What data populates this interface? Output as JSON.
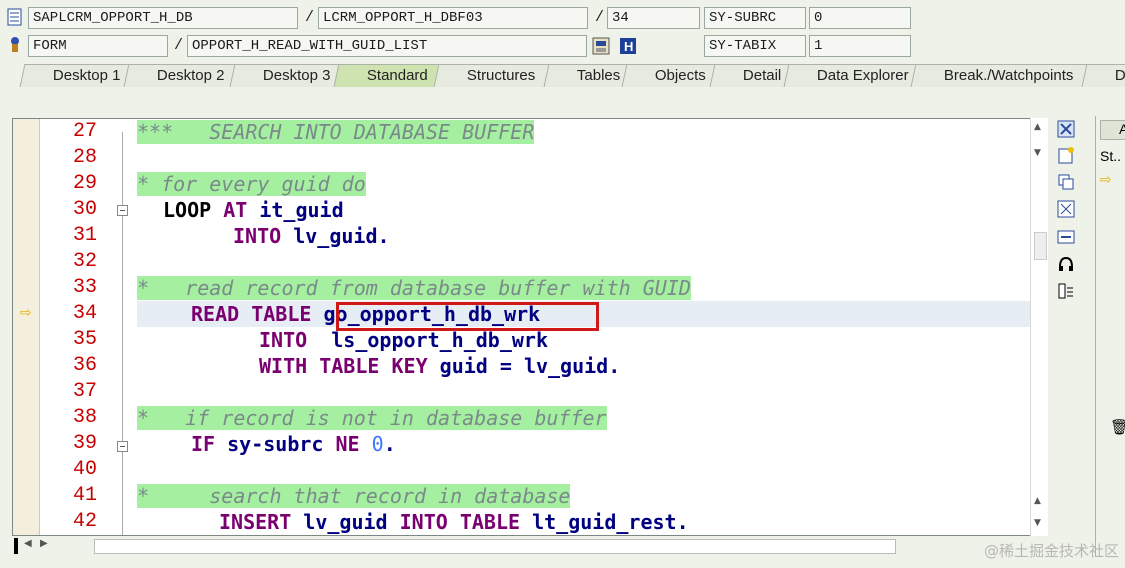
{
  "header": {
    "row1": {
      "program": "SAPLCRM_OPPORT_H_DB",
      "include": "LCRM_OPPORT_H_DBF03",
      "line": "34",
      "sysvar_label": "SY-SUBRC",
      "sysvar_value": "0"
    },
    "row2": {
      "type": "FORM",
      "name": "OPPORT_H_READ_WITH_GUID_LIST",
      "sysvar_label": "SY-TABIX",
      "sysvar_value": "1"
    }
  },
  "tabs": [
    "Desktop 1",
    "Desktop 2",
    "Desktop 3",
    "Standard",
    "Structures",
    "Tables",
    "Objects",
    "Detail",
    "Data Explorer",
    "Break./Watchpoints",
    "Diff"
  ],
  "active_tab": "Standard",
  "code": {
    "current_line": "34",
    "highlighted_token": "go_opport_h_db_wrk",
    "lines": [
      {
        "num": "27",
        "text": "***   SEARCH INTO DATABASE BUFFER"
      },
      {
        "num": "28",
        "text": ""
      },
      {
        "num": "29",
        "text": "* for every guid do"
      },
      {
        "num": "30",
        "text": "LOOP AT it_guid"
      },
      {
        "num": "31",
        "text": "INTO lv_guid."
      },
      {
        "num": "32",
        "text": ""
      },
      {
        "num": "33",
        "text": "*   read record from database buffer with GUID"
      },
      {
        "num": "34",
        "text": "READ TABLE go_opport_h_db_wrk"
      },
      {
        "num": "35",
        "text": "INTO  ls_opport_h_db_wrk"
      },
      {
        "num": "36",
        "text": "WITH TABLE KEY guid = lv_guid."
      },
      {
        "num": "37",
        "text": ""
      },
      {
        "num": "38",
        "text": "*   if record is not in database buffer"
      },
      {
        "num": "39",
        "text": "IF sy-subrc NE 0."
      },
      {
        "num": "40",
        "text": ""
      },
      {
        "num": "41",
        "text": "*     search that record in database"
      },
      {
        "num": "42",
        "text": "INSERT lv_guid INTO TABLE lt_guid_rest."
      }
    ]
  },
  "right_panel": {
    "col_a": "A",
    "col_st": "St.."
  },
  "watermark": "@稀土掘金技术社区",
  "icons": [
    "program-icon",
    "form-icon",
    "close-icon",
    "new-icon",
    "swap-icon",
    "fullscreen-icon",
    "resize-icon",
    "headset-icon",
    "settings-icon",
    "delete-icon"
  ]
}
